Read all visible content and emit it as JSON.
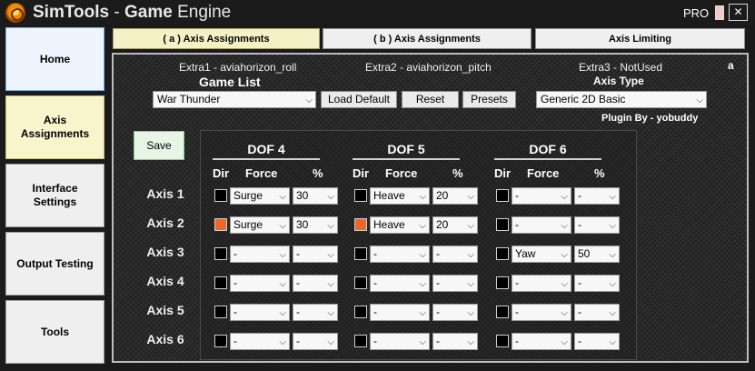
{
  "window": {
    "title_part1": "SimTools",
    "title_sep": " - ",
    "title_part2": "Game",
    "title_part3": " Engine",
    "pro_label": "PRO",
    "close_label": "✕"
  },
  "sidebar": {
    "items": [
      {
        "label": "Home"
      },
      {
        "label": "Axis Assignments"
      },
      {
        "label": "Interface Settings"
      },
      {
        "label": "Output Testing"
      },
      {
        "label": "Tools"
      }
    ]
  },
  "tabs": [
    {
      "label": "( a ) Axis Assignments",
      "active": true
    },
    {
      "label": "( b ) Axis Assignments",
      "active": false
    },
    {
      "label": "Axis Limiting",
      "active": false
    }
  ],
  "extras": {
    "extra1": "Extra1 - aviahorizon_roll",
    "extra2": "Extra2 - aviahorizon_pitch",
    "extra3": "Extra3 - NotUsed",
    "corner": "a"
  },
  "game_list": {
    "title": "Game List",
    "selected": "War Thunder",
    "load_default": "Load Default",
    "reset": "Reset",
    "presets": "Presets"
  },
  "axis_type": {
    "title": "Axis Type",
    "selected": "Generic 2D Basic",
    "plugin_by": "Plugin By - yobuddy"
  },
  "save_label": "Save",
  "chevron": "⌵",
  "axis_labels": [
    "Axis 1",
    "Axis 2",
    "Axis 3",
    "Axis 4",
    "Axis 5",
    "Axis 6"
  ],
  "column_headers": {
    "dir": "Dir",
    "force": "Force",
    "percent": "%"
  },
  "dofs": [
    {
      "name": "DOF 4",
      "rows": [
        {
          "dir": false,
          "force": "Surge",
          "pct": "30"
        },
        {
          "dir": true,
          "force": "Surge",
          "pct": "30"
        },
        {
          "dir": false,
          "force": "-",
          "pct": "-"
        },
        {
          "dir": false,
          "force": "-",
          "pct": "-"
        },
        {
          "dir": false,
          "force": "-",
          "pct": "-"
        },
        {
          "dir": false,
          "force": "-",
          "pct": "-"
        }
      ]
    },
    {
      "name": "DOF 5",
      "rows": [
        {
          "dir": false,
          "force": "Heave",
          "pct": "20"
        },
        {
          "dir": true,
          "force": "Heave",
          "pct": "20"
        },
        {
          "dir": false,
          "force": "-",
          "pct": "-"
        },
        {
          "dir": false,
          "force": "-",
          "pct": "-"
        },
        {
          "dir": false,
          "force": "-",
          "pct": "-"
        },
        {
          "dir": false,
          "force": "-",
          "pct": "-"
        }
      ]
    },
    {
      "name": "DOF 6",
      "rows": [
        {
          "dir": false,
          "force": "-",
          "pct": "-"
        },
        {
          "dir": false,
          "force": "-",
          "pct": "-"
        },
        {
          "dir": false,
          "force": "Yaw",
          "pct": "50"
        },
        {
          "dir": false,
          "force": "-",
          "pct": "-"
        },
        {
          "dir": false,
          "force": "-",
          "pct": "-"
        },
        {
          "dir": false,
          "force": "-",
          "pct": "-"
        }
      ]
    }
  ],
  "colors": {
    "dir_on": "#f26522",
    "dir_off": "#000000"
  }
}
